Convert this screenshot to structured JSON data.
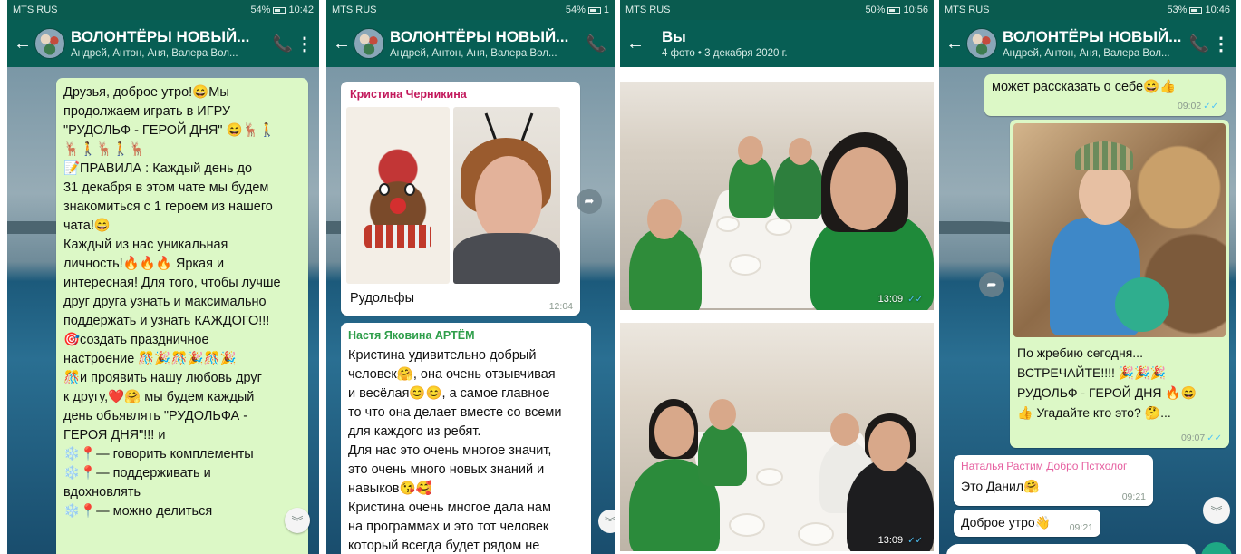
{
  "panels": [
    {
      "status": {
        "carrier": "MTS RUS",
        "battery": "54%",
        "time": "10:42"
      },
      "appbar": {
        "title": "ВОЛОНТЁРЫ НОВЫЙ...",
        "subtitle": "Андрей, Антон, Аня, Валера Вол..."
      },
      "message": {
        "lines": [
          "Друзья, доброе утро!😄Мы",
          "продолжаем играть в ИГРУ",
          "\"РУДОЛЬФ - ГЕРОЙ ДНЯ\" 😄🦌🚶",
          "🦌🚶🦌🚶🦌",
          "📝ПРАВИЛА : Каждый день до",
          "31 декабря в этом чате мы будем",
          "знакомиться с 1 героем из нашего",
          "чата!😄",
          "Каждый из нас уникальная",
          "личность!🔥🔥🔥 Яркая и",
          "интересная! Для того, чтобы лучше",
          "друг друга узнать и максимально",
          "поддержать и узнать КАЖДОГО!!!",
          "🎯создать праздничное",
          "настроение 🎊🎉🎊🎉🎊🎉",
          "🎊и проявить нашу любовь друг",
          "к другу,❤️🤗 мы будем каждый",
          "день объявлять \"РУДОЛЬФА -",
          "ГЕРОЯ ДНЯ\"!!! и",
          "❄️📍— говорить комплементы",
          "❄️📍— поддерживать и",
          "вдохновлять",
          "❄️📍— можно делиться"
        ]
      }
    },
    {
      "status": {
        "carrier": "MTS RUS",
        "battery": "54%",
        "time": "1"
      },
      "appbar": {
        "title": "ВОЛОНТЁРЫ НОВЫЙ...",
        "subtitle": "Андрей, Антон, Аня, Валера Вол..."
      },
      "msg1": {
        "sender": "Кристина Черникина",
        "caption": "Рудольфы",
        "time": "12:04"
      },
      "msg2": {
        "sender": "Настя Яковина АРТЁМ",
        "lines": [
          "Кристина удивительно добрый",
          "человек🤗, она очень отзывчивая",
          "и весёлая😊😊, а самое главное",
          "то что она делает вместе со всеми",
          "для каждого из ребят.",
          "Для нас это очень многое значит,",
          "это очень много новых знаний и",
          "навыков😘🥰",
          "Кристина очень многое дала нам",
          "на программах и это тот человек",
          "который всегда будет рядом не"
        ]
      }
    },
    {
      "status": {
        "carrier": "MTS RUS",
        "battery": "50%",
        "time": "10:56"
      },
      "appbar": {
        "title": "Вы",
        "subtitle": "4 фото • 3 декабря 2020 г."
      },
      "photos": [
        {
          "time": "13:09"
        },
        {
          "time": "13:09"
        }
      ]
    },
    {
      "status": {
        "carrier": "MTS RUS",
        "battery": "53%",
        "time": "10:46"
      },
      "appbar": {
        "title": "ВОЛОНТЁРЫ НОВЫЙ...",
        "subtitle": "Андрей, Антон, Аня, Валера Вол..."
      },
      "msg1": {
        "text": "может рассказать о себе😄👍",
        "time": "09:02"
      },
      "msg2": {
        "lines": [
          "По жребию сегодня...",
          "ВСТРЕЧАЙТЕ!!!! 🎉🎉🎉",
          "РУДОЛЬФ - ГЕРОЙ ДНЯ 🔥😄",
          "👍 Угадайте кто это? 🤔..."
        ],
        "time": "09:07"
      },
      "msg3": {
        "sender": "Наталья Растим Добро Пстхолог",
        "text": "Это Данил🤗",
        "time": "09:21"
      },
      "msg4": {
        "text": "Доброе утро👋",
        "time": "09:21"
      }
    }
  ],
  "icons": {
    "back": "←",
    "call": "📞",
    "menu": "⋮",
    "forward": "➦",
    "scroll_down": "︾",
    "tick": "✓✓"
  }
}
